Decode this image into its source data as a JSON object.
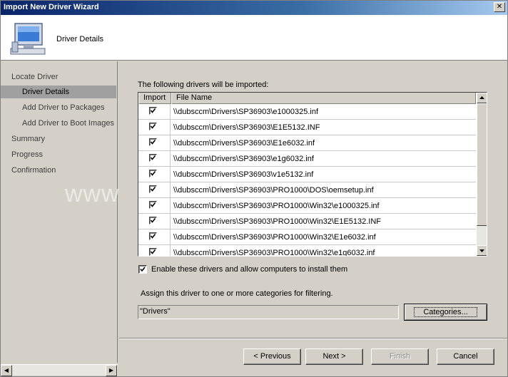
{
  "window": {
    "title": "Import New Driver Wizard"
  },
  "header": {
    "heading": "Driver Details"
  },
  "sidebar": {
    "items": [
      {
        "label": "Locate Driver"
      },
      {
        "label": "Driver Details"
      },
      {
        "label": "Add Driver to Packages"
      },
      {
        "label": "Add Driver to Boot Images"
      },
      {
        "label": "Summary"
      },
      {
        "label": "Progress"
      },
      {
        "label": "Confirmation"
      }
    ]
  },
  "main": {
    "intro": "The following drivers will be imported:",
    "columns": {
      "import": "Import",
      "file_name": "File Name"
    },
    "rows": [
      {
        "checked": true,
        "file": "\\\\dubsccm\\Drivers\\SP36903\\e1000325.inf"
      },
      {
        "checked": true,
        "file": "\\\\dubsccm\\Drivers\\SP36903\\E1E5132.INF"
      },
      {
        "checked": true,
        "file": "\\\\dubsccm\\Drivers\\SP36903\\E1e6032.inf"
      },
      {
        "checked": true,
        "file": "\\\\dubsccm\\Drivers\\SP36903\\e1g6032.inf"
      },
      {
        "checked": true,
        "file": "\\\\dubsccm\\Drivers\\SP36903\\v1e5132.inf"
      },
      {
        "checked": true,
        "file": "\\\\dubsccm\\Drivers\\SP36903\\PRO1000\\DOS\\oemsetup.inf"
      },
      {
        "checked": true,
        "file": "\\\\dubsccm\\Drivers\\SP36903\\PRO1000\\Win32\\e1000325.inf"
      },
      {
        "checked": true,
        "file": "\\\\dubsccm\\Drivers\\SP36903\\PRO1000\\Win32\\E1E5132.INF"
      },
      {
        "checked": true,
        "file": "\\\\dubsccm\\Drivers\\SP36903\\PRO1000\\Win32\\E1e6032.inf"
      },
      {
        "checked": true,
        "file": "\\\\dubsccm\\Drivers\\SP36903\\PRO1000\\Win32\\e1g6032.inf"
      }
    ],
    "enable_label": "Enable these drivers and allow computers to install them",
    "assign_label": "Assign this driver to one or more categories for filtering.",
    "categories_value": "\"Drivers\"",
    "categories_button": "Categories..."
  },
  "footer": {
    "previous": "< Previous",
    "next": "Next >",
    "finish": "Finish",
    "cancel": "Cancel"
  },
  "watermark": "www"
}
